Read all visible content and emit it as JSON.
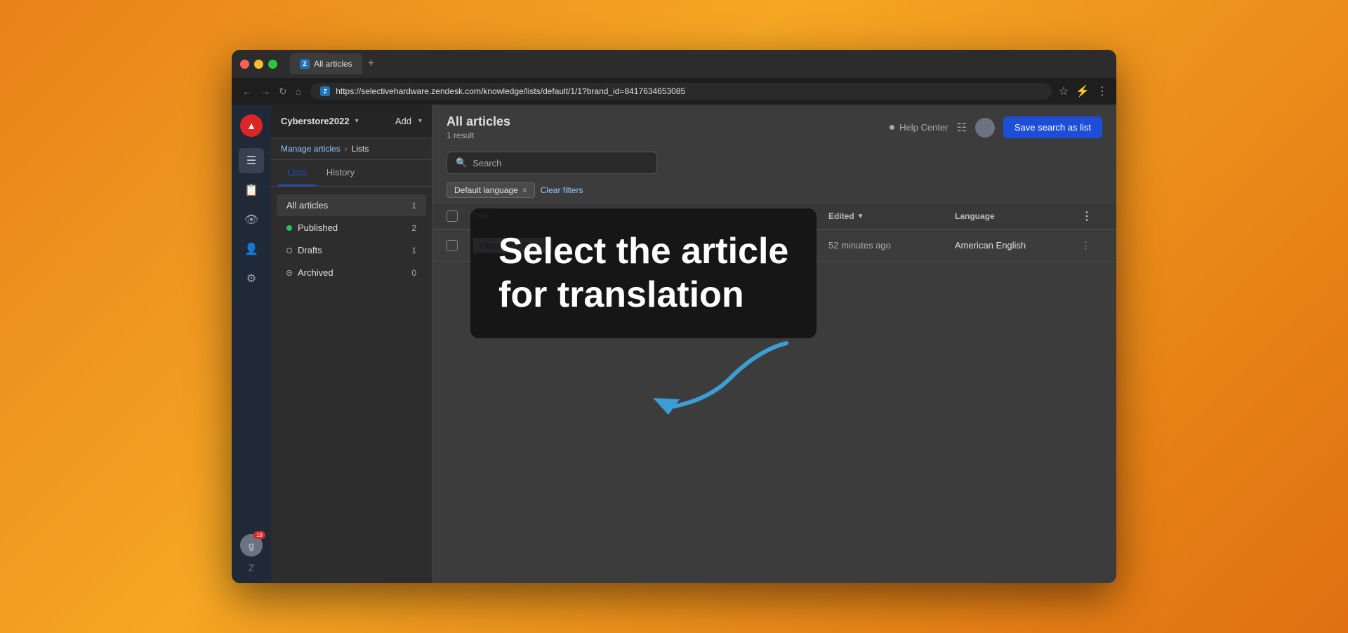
{
  "browser": {
    "tab_title": "All articles",
    "url": "https://selectivehardware.zendesk.com/knowledge/lists/default/1/1?brand_id=8417634653085",
    "tab_favicon": "Z",
    "url_favicon": "Z"
  },
  "header": {
    "workspace": "Cyberstore2022",
    "add_label": "Add",
    "manage_articles": "Manage articles",
    "separator": "›",
    "lists_label": "Lists",
    "help_center": "Help Center"
  },
  "left_panel": {
    "tabs": [
      {
        "label": "Lists",
        "active": true
      },
      {
        "label": "History",
        "active": false
      }
    ],
    "items": [
      {
        "label": "All articles",
        "count": "1",
        "type": "all",
        "active": true
      },
      {
        "label": "Published",
        "count": "2",
        "type": "published"
      },
      {
        "label": "Drafts",
        "count": "1",
        "type": "drafts"
      },
      {
        "label": "Archived",
        "count": "0",
        "type": "archived"
      }
    ]
  },
  "right_panel": {
    "page_title": "All articles",
    "result_count": "1 result",
    "save_search_label": "Save search as list",
    "search_placeholder": "Search",
    "filter_tag_label": "Default language",
    "clear_filters_label": "Clear filters",
    "table": {
      "columns": [
        {
          "label": ""
        },
        {
          "label": "Title"
        },
        {
          "label": "Edited"
        },
        {
          "label": "Language"
        },
        {
          "label": ""
        }
      ],
      "rows": [
        {
          "title": "Integrated circuit",
          "edited": "52 minutes ago",
          "language": "American English"
        }
      ]
    }
  },
  "overlay": {
    "text_line1": "Select the article",
    "text_line2": "for translation"
  },
  "sidebar": {
    "icons": [
      "☰",
      "📋",
      "👁",
      "👤",
      "⚙"
    ]
  },
  "notification_count": "19"
}
